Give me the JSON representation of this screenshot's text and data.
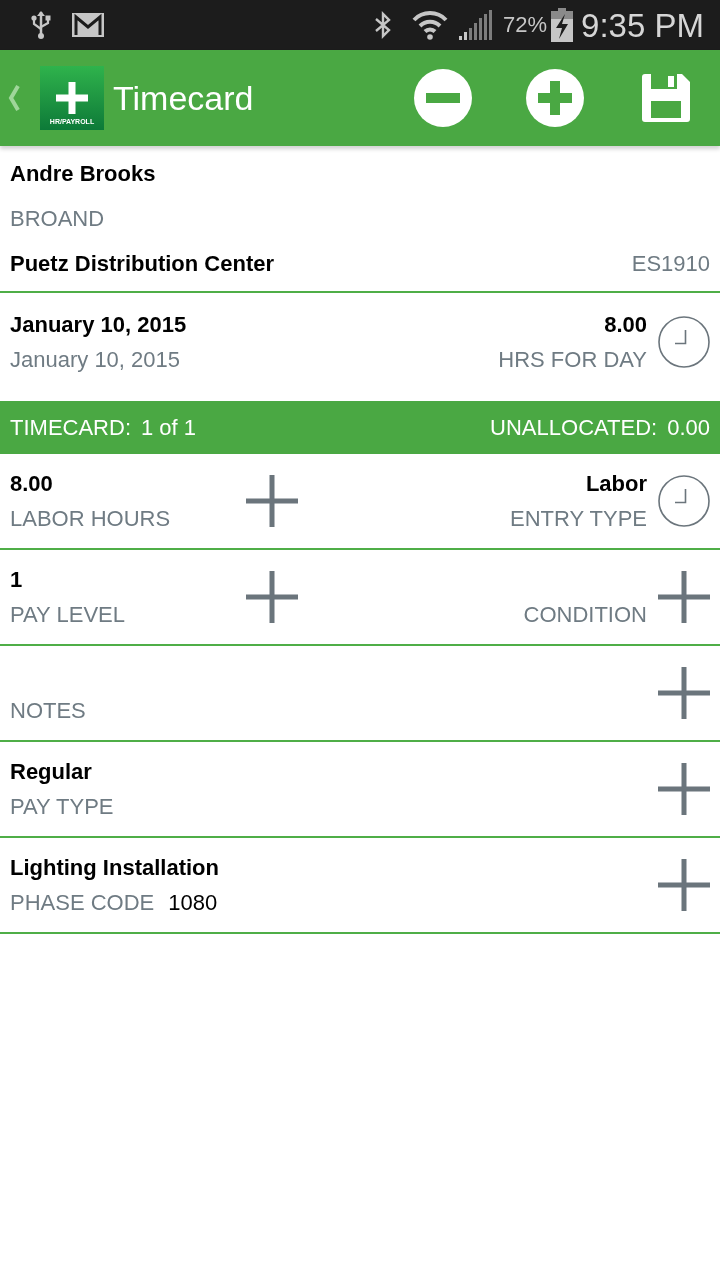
{
  "status_bar": {
    "battery": "72%",
    "time": "9:35 PM"
  },
  "app_bar": {
    "logo_label": "HR/PAYROLL",
    "title": "Timecard"
  },
  "employee": {
    "name": "Andre Brooks",
    "code": "BROAND",
    "location": "Puetz Distribution Center",
    "location_code": "ES1910"
  },
  "day": {
    "date": "January 10, 2015",
    "date_subtitle": "January 10, 2015",
    "hours": "8.00",
    "hours_label": "HRS FOR DAY"
  },
  "timecard_bar": {
    "label": "TIMECARD:",
    "count": "1 of 1",
    "unallocated_label": "UNALLOCATED:",
    "unallocated": "0.00"
  },
  "rows": [
    {
      "fields": [
        {
          "kind": "add",
          "value": "8.00",
          "label": "LABOR HOURS"
        },
        {
          "kind": "clock",
          "value": "Labor",
          "label": "ENTRY TYPE"
        }
      ]
    },
    {
      "fields": [
        {
          "kind": "add",
          "value": "1",
          "label": "PAY LEVEL"
        },
        {
          "kind": "add",
          "label": "CONDITION"
        }
      ]
    },
    {
      "fields": [
        {
          "kind": "add",
          "label": "NOTES"
        }
      ]
    },
    {
      "fields": [
        {
          "kind": "add",
          "value": "Regular",
          "label": "PAY TYPE"
        }
      ]
    },
    {
      "fields": [
        {
          "kind": "add",
          "value": "Lighting Installation",
          "label": "PHASE CODE",
          "code": "1080"
        }
      ]
    }
  ]
}
